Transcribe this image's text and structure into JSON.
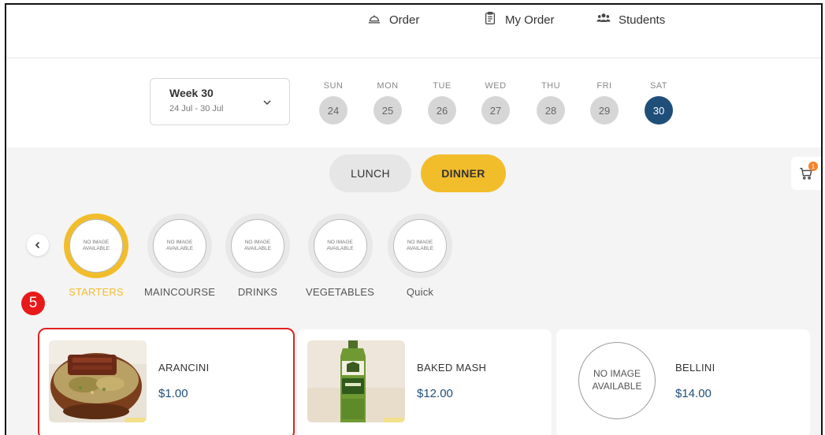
{
  "nav": {
    "order": "Order",
    "my_order": "My Order",
    "students": "Students"
  },
  "week": {
    "title": "Week 30",
    "range": "24 Jul - 30 Jul"
  },
  "days": [
    {
      "name": "SUN",
      "num": "24",
      "active": false
    },
    {
      "name": "MON",
      "num": "25",
      "active": false
    },
    {
      "name": "TUE",
      "num": "26",
      "active": false
    },
    {
      "name": "WED",
      "num": "27",
      "active": false
    },
    {
      "name": "THU",
      "num": "28",
      "active": false
    },
    {
      "name": "FRI",
      "num": "29",
      "active": false
    },
    {
      "name": "SAT",
      "num": "30",
      "active": true
    }
  ],
  "meal": {
    "lunch": "LUNCH",
    "dinner": "DINNER",
    "selected": "DINNER"
  },
  "cart": {
    "count": "1"
  },
  "no_image_text": "NO IMAGE AVAILABLE",
  "categories": [
    {
      "label": "STARTERS",
      "active": true
    },
    {
      "label": "MAINCOURSE",
      "active": false
    },
    {
      "label": "DRINKS",
      "active": false
    },
    {
      "label": "VEGETABLES",
      "active": false
    },
    {
      "label": "Quick",
      "active": false
    }
  ],
  "step": "5",
  "items": [
    {
      "name": "ARANCINI",
      "price": "$1.00"
    },
    {
      "name": "BAKED MASH",
      "price": "$12.00"
    },
    {
      "name": "BELLINI",
      "price": "$14.00",
      "image": "NO IMAGE AVAILABLE"
    }
  ],
  "colors": {
    "accent_yellow": "#f2bd2a",
    "active_day": "#1f4e79",
    "price": "#1f4e79",
    "highlight": "#e02020",
    "step_badge": "#e81919",
    "cart_badge": "#f5822a"
  }
}
